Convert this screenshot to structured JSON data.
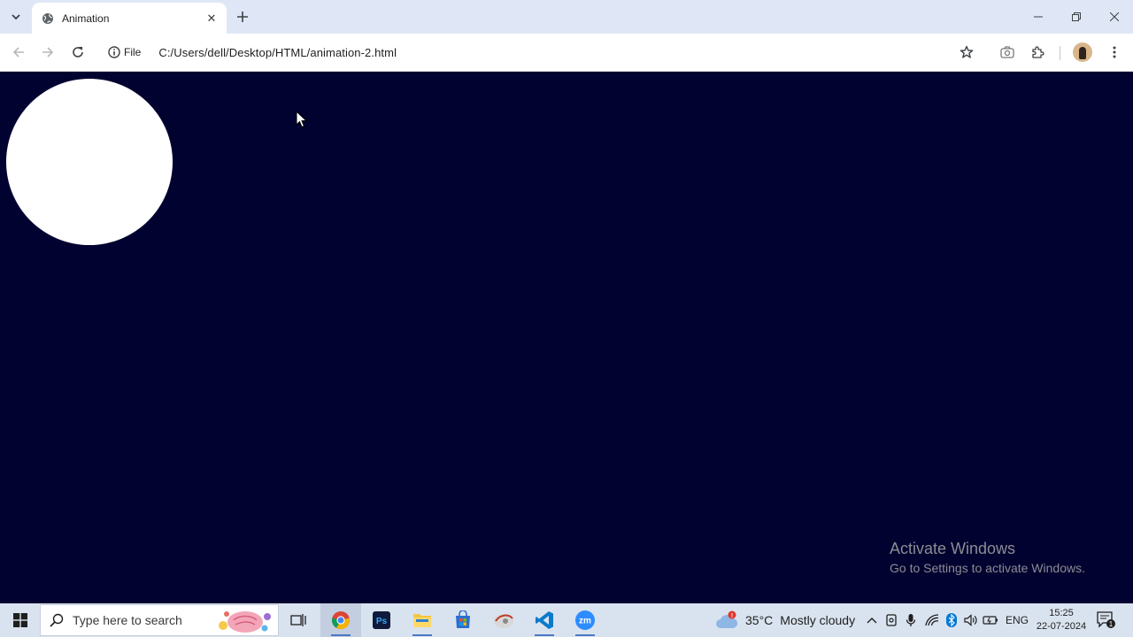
{
  "browser": {
    "tab": {
      "title": "Animation",
      "favicon": "globe-icon"
    },
    "address": {
      "security_label": "File",
      "url": "C:/Users/dell/Desktop/HTML/animation-2.html"
    }
  },
  "page": {
    "background_color": "#020230",
    "circle_color": "#ffffff"
  },
  "watermark": {
    "title": "Activate Windows",
    "subtitle": "Go to Settings to activate Windows."
  },
  "taskbar": {
    "search_placeholder": "Type here to search",
    "apps": [
      "task-view",
      "chrome",
      "photoshop",
      "file-explorer",
      "microsoft-store",
      "app",
      "vscode",
      "zoom"
    ],
    "weather": {
      "temperature": "35°C",
      "condition": "Mostly cloudy",
      "alert_badge": "!"
    },
    "language": "ENG",
    "clock": {
      "time": "15:25",
      "date": "22-07-2024"
    },
    "notification_count": "1"
  }
}
